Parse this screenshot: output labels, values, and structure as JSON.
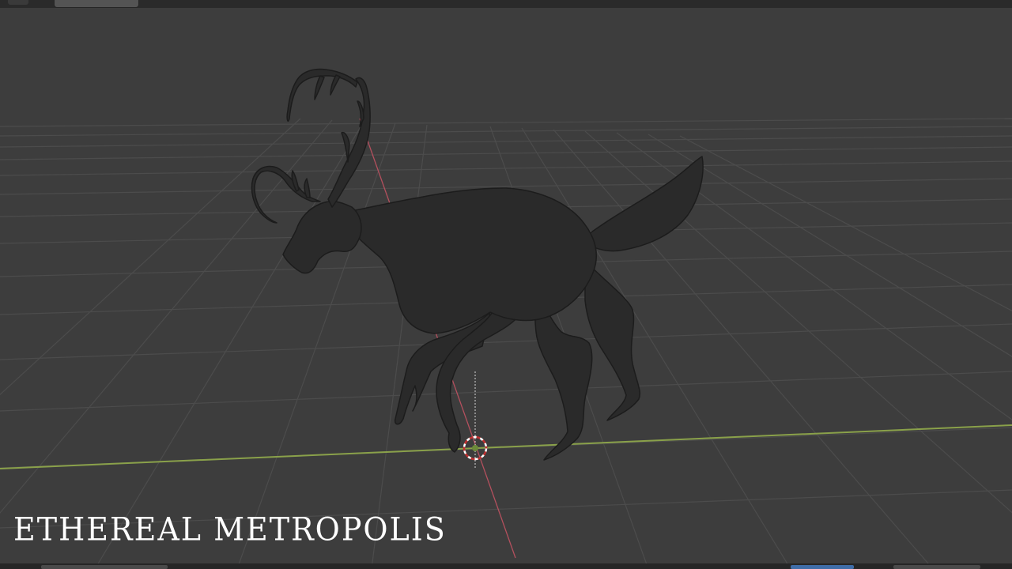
{
  "viewport": {
    "watermark_text": "ETHEREAL METROPOLIS",
    "background_color": "#3d3d3d",
    "grid_color": "#4c4c4c",
    "x_axis_color": "#8aa14a",
    "y_axis_color": "#b4505e",
    "model_color": "#2a2a2a",
    "objects": [
      "deer-creature-mesh",
      "3d-cursor",
      "grid-floor"
    ]
  }
}
